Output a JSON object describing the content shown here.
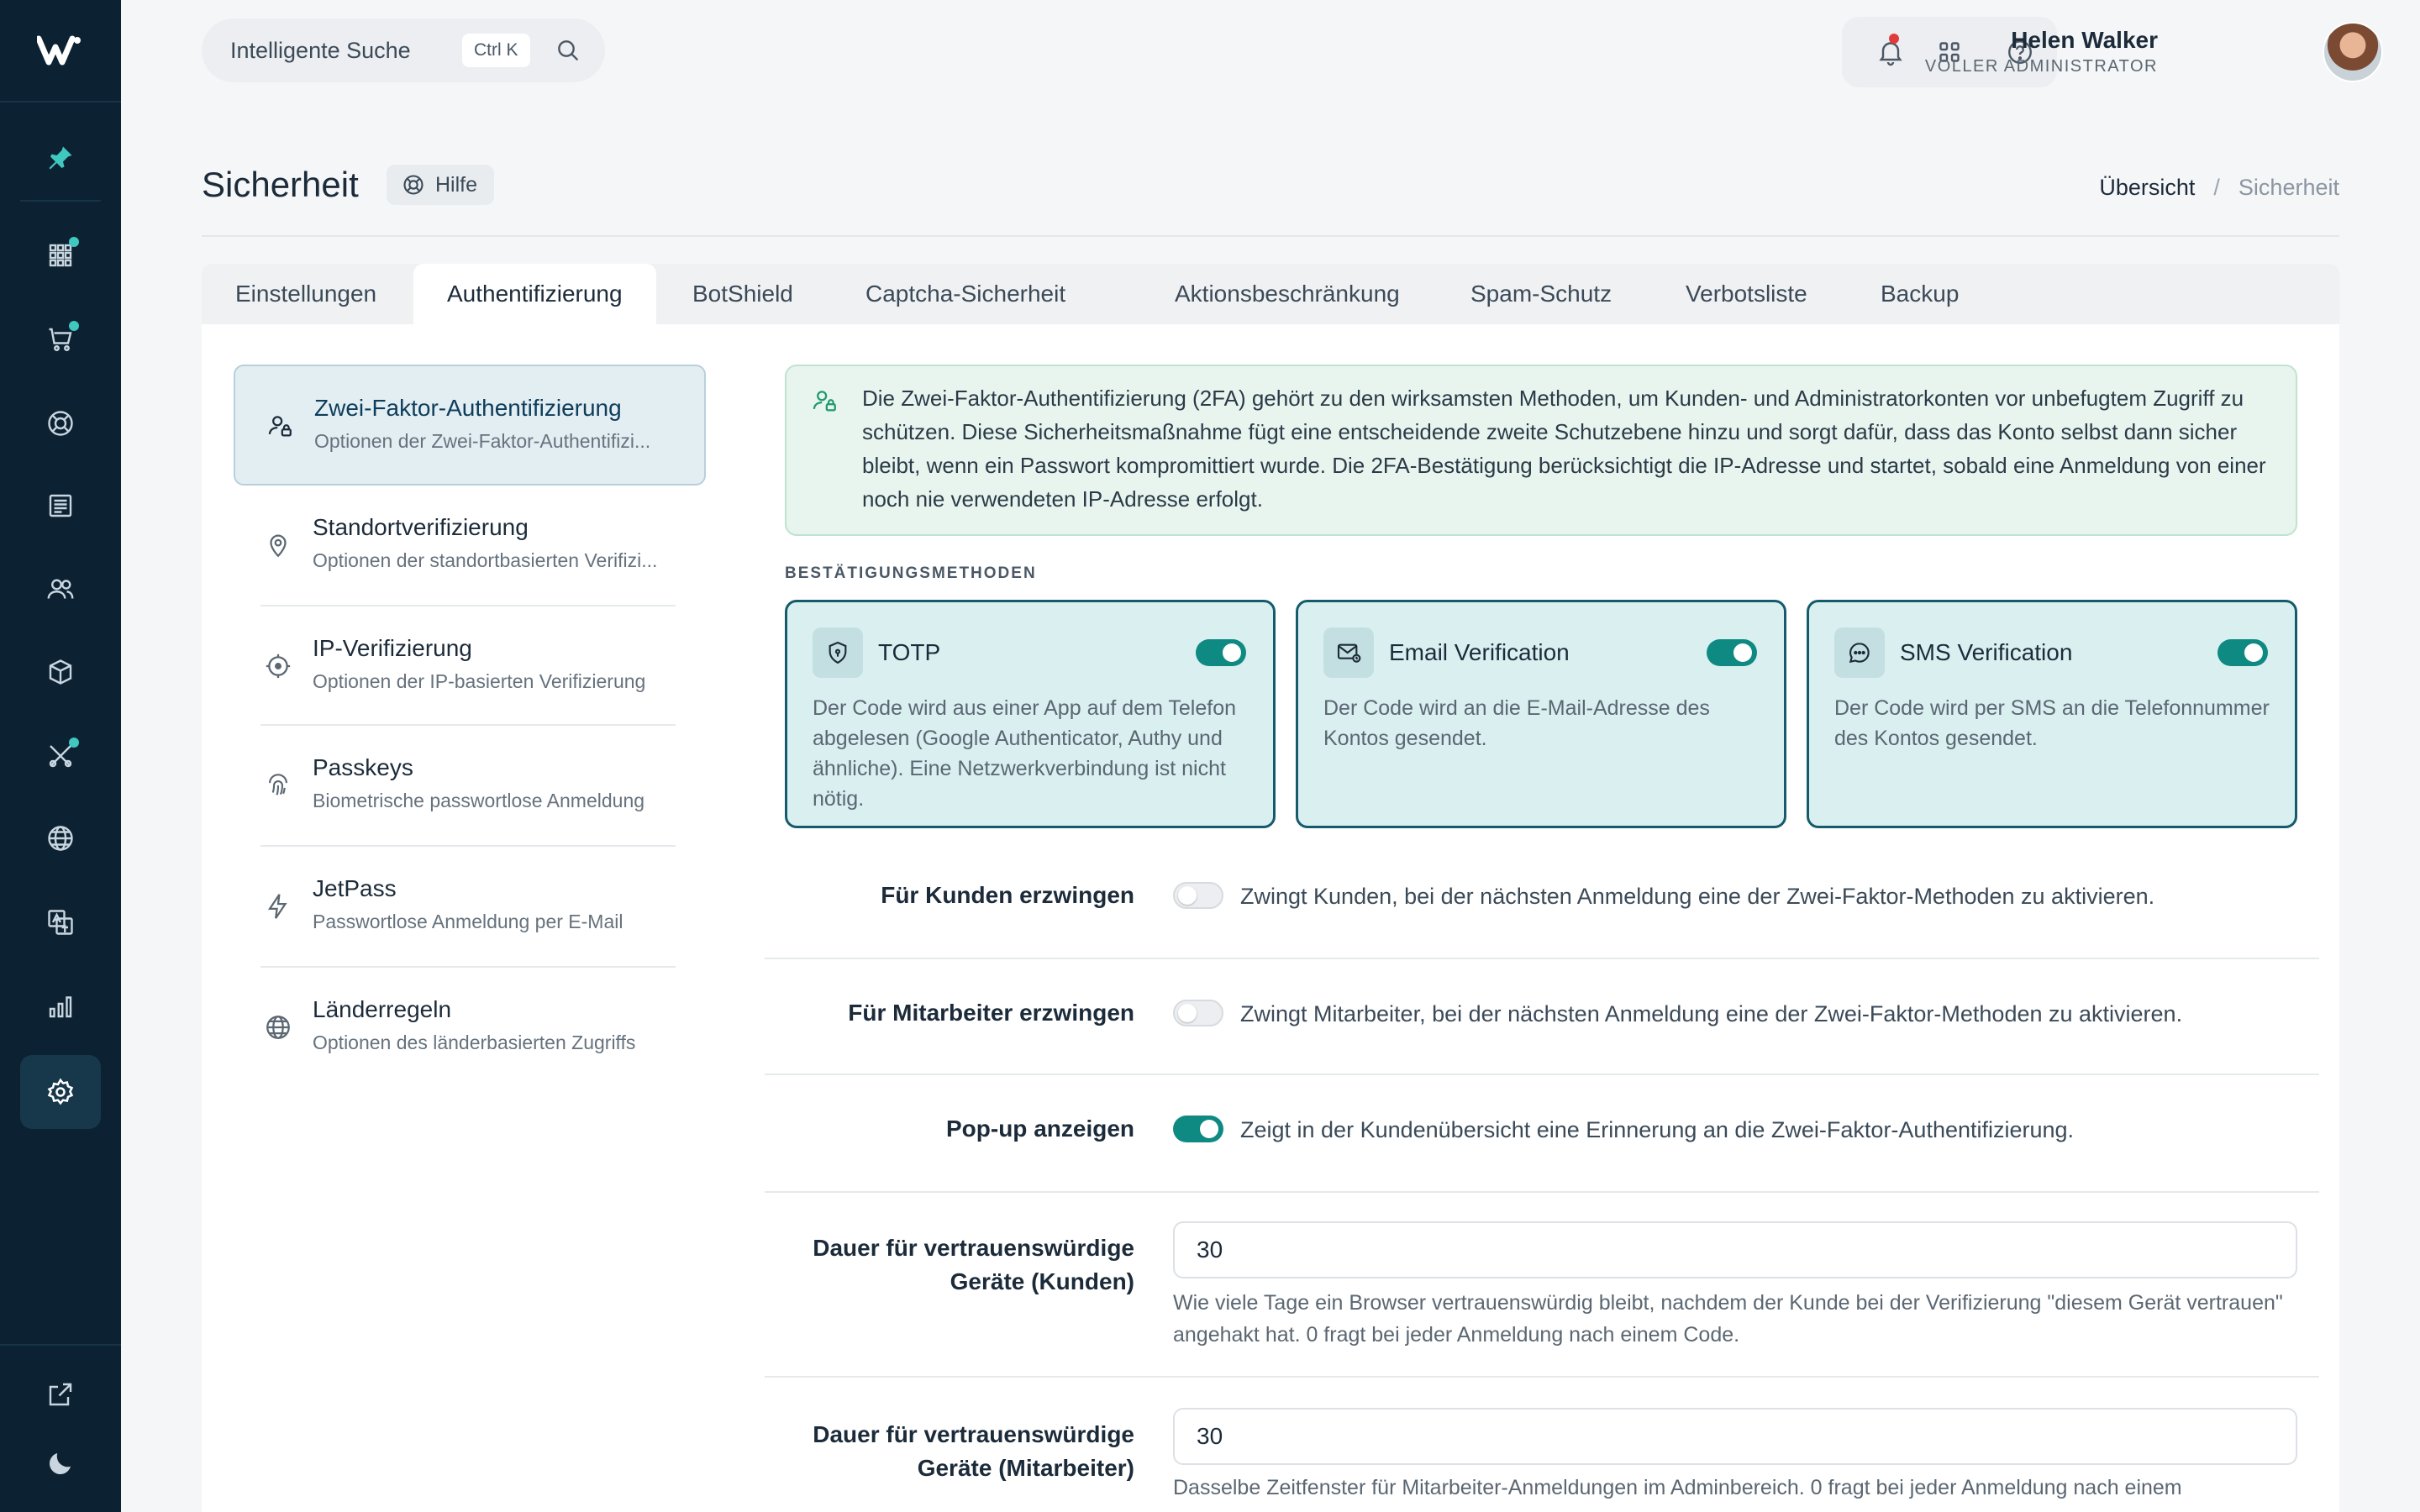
{
  "search": {
    "placeholder": "Intelligente Suche",
    "shortcut": "Ctrl K"
  },
  "user": {
    "name": "Helen Walker",
    "role": "VOLLER ADMINISTRATOR"
  },
  "page": {
    "title": "Sicherheit",
    "help": "Hilfe"
  },
  "breadcrumb": {
    "home": "Übersicht",
    "sep": "/",
    "current": "Sicherheit"
  },
  "tabs": [
    "Einstellungen",
    "Authentifizierung",
    "BotShield",
    "Captcha-Sicherheit",
    "Aktionsbeschränkung",
    "Spam-Schutz",
    "Verbotsliste",
    "Backup"
  ],
  "menu": [
    {
      "title": "Zwei-Faktor-Authentifizierung",
      "sub": "Optionen der Zwei-Faktor-Authentifizi..."
    },
    {
      "title": "Standortverifizierung",
      "sub": "Optionen der standortbasierten Verifizi..."
    },
    {
      "title": "IP-Verifizierung",
      "sub": "Optionen der IP-basierten Verifizierung"
    },
    {
      "title": "Passkeys",
      "sub": "Biometrische passwortlose Anmeldung"
    },
    {
      "title": "JetPass",
      "sub": "Passwortlose Anmeldung per E-Mail"
    },
    {
      "title": "Länderregeln",
      "sub": "Optionen des länderbasierten Zugriffs"
    }
  ],
  "info": "Die Zwei-Faktor-Authentifizierung (2FA) gehört zu den wirksamsten Methoden, um Kunden- und Administratorkonten vor unbefugtem Zugriff zu schützen. Diese Sicherheitsmaßnahme fügt eine entscheidende zweite Schutzebene hinzu und sorgt dafür, dass das Konto selbst dann sicher bleibt, wenn ein Passwort kompromittiert wurde. Die 2FA-Bestätigung berücksichtigt die IP-Adresse und startet, sobald eine Anmeldung von einer noch nie verwendeten IP-Adresse erfolgt.",
  "methods_label": "BESTÄTIGUNGSMETHODEN",
  "methods": [
    {
      "title": "TOTP",
      "desc": "Der Code wird aus einer App auf dem Telefon abgelesen (Google Authenticator, Authy und ähnliche). Eine Netzwerkverbindung ist nicht nötig.",
      "enabled": true
    },
    {
      "title": "Email Verification",
      "desc": "Der Code wird an die E-Mail-Adresse des Kontos gesendet.",
      "enabled": true
    },
    {
      "title": "SMS Verification",
      "desc": "Der Code wird per SMS an die Telefonnummer des Kontos gesendet.",
      "enabled": true
    }
  ],
  "settings": {
    "enforce_customers": {
      "label": "Für Kunden erzwingen",
      "text": "Zwingt Kunden, bei der nächsten Anmeldung eine der Zwei-Faktor-Methoden zu aktivieren.",
      "enabled": false
    },
    "enforce_staff": {
      "label": "Für Mitarbeiter erzwingen",
      "text": "Zwingt Mitarbeiter, bei der nächsten Anmeldung eine der Zwei-Faktor-Methoden zu aktivieren.",
      "enabled": false
    },
    "popup": {
      "label": "Pop-up anzeigen",
      "text": "Zeigt in der Kundenübersicht eine Erinnerung an die Zwei-Faktor-Authentifizierung.",
      "enabled": true
    },
    "trust_customers": {
      "label_1": "Dauer für vertrauenswürdige",
      "label_2": "Geräte (Kunden)",
      "value": "30",
      "help": "Wie viele Tage ein Browser vertrauenswürdig bleibt, nachdem der Kunde bei der Verifizierung \"diesem Gerät vertrauen\" angehakt hat. 0 fragt bei jeder Anmeldung nach einem Code."
    },
    "trust_staff": {
      "label_1": "Dauer für vertrauenswürdige",
      "label_2": "Geräte (Mitarbeiter)",
      "value": "30",
      "help": "Dasselbe Zeitfenster für Mitarbeiter-Anmeldungen im Adminbereich. 0 fragt bei jeder Anmeldung nach einem"
    }
  },
  "colors": {
    "sidebar": "#0c2233",
    "accent": "#0f8a82",
    "dot": "#3fc7c0",
    "notification": "#e23b3b"
  }
}
